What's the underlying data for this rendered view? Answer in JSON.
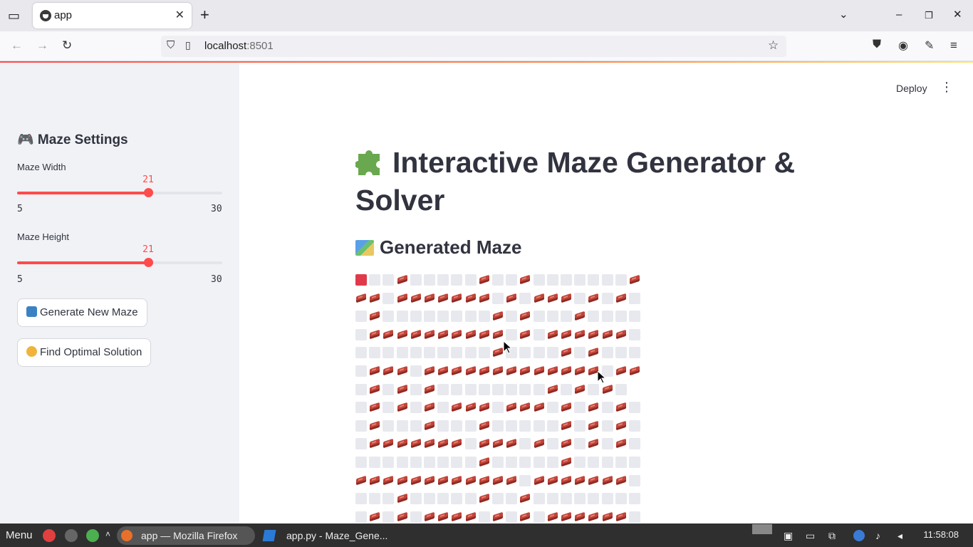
{
  "browser": {
    "tab_title": "app",
    "url_host": "localhost",
    "url_port": ":8501"
  },
  "sidebar": {
    "header": "🎮 Maze Settings",
    "width_slider": {
      "label": "Maze Width",
      "value": "21",
      "min": "5",
      "max": "30",
      "fraction": 0.64
    },
    "height_slider": {
      "label": "Maze Height",
      "value": "21",
      "min": "5",
      "max": "30",
      "fraction": 0.64
    },
    "generate_button": "Generate New Maze",
    "solve_button": "Find Optimal Solution"
  },
  "main": {
    "deploy_label": "Deploy",
    "title": "Interactive Maze Generator & Solver",
    "subheader": "Generated Maze",
    "maze_rows": [
      "S..#.....#..#.......#.",
      "##.#######.#.###.#.#.",
      ".#........#.#...#....",
      ".##########.#.######.",
      "..........#....#.#...",
      ".###.#############.##",
      ".#.#.#........#.#.#.",
      ".#.#.#.###.###.#.#.#.",
      ".#...#...#.....#.#.#.",
      ".#######.###.#.#.#.#.",
      ".........#.....#.....",
      "############.#######.",
      "...#.....#..#........",
      ".#.#.####.#.#.######."
    ]
  },
  "taskbar": {
    "menu": "Menu",
    "firefox_label": "app — Mozilla Firefox",
    "vscode_label": "app.py - Maze_Gene...",
    "clock": "11:58:08"
  },
  "colors": {
    "accent": "#ff4b4b",
    "sidebar_bg": "#f0f2f6",
    "text": "#31333f",
    "start_cell": "#e03a4a",
    "wall_brick": "#c1443a"
  }
}
